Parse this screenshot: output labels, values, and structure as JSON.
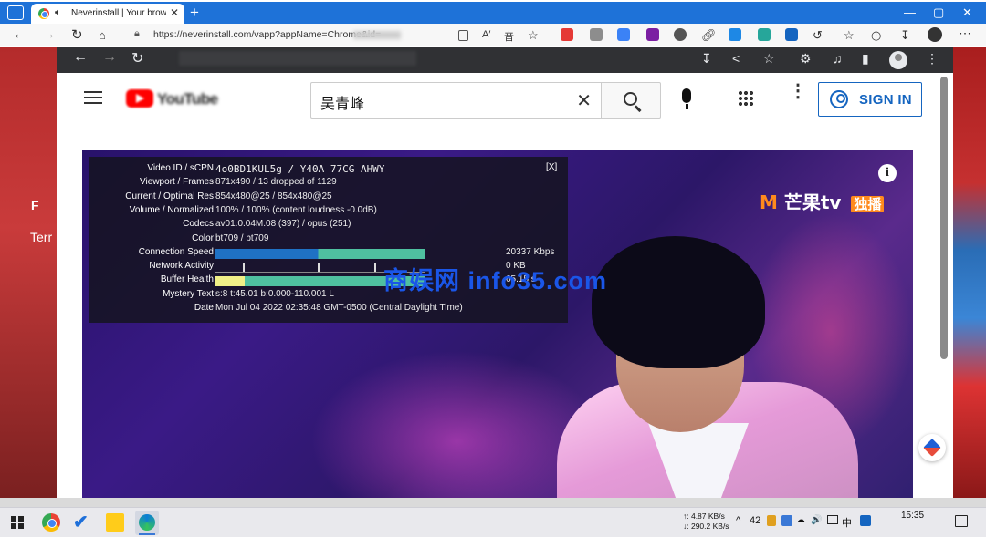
{
  "browser": {
    "tab_title": "Neverinstall | Your browser",
    "new_tab": "+",
    "tab_close": "✕",
    "url": "https://neverinstall.com/vapp?appName=Chrome&id=",
    "window_controls": {
      "minimize": "—",
      "maximize": "▢",
      "close": "✕"
    }
  },
  "desktop": {
    "left_label": "Terr",
    "left_letter": "F"
  },
  "youtube": {
    "logo_text": "YouTube",
    "search_value": "吴青峰",
    "clear_icon": "✕",
    "more_icon": "⋮",
    "sign_in": "SIGN IN"
  },
  "video": {
    "channel_logo_prefix": "M",
    "channel_logo": "芒果tv",
    "channel_badge": "独播",
    "info_icon": "i",
    "watermark": "商娱网 info35.com",
    "stats_close": "[X]",
    "stats": [
      {
        "key": "Video ID / sCPN",
        "value": "4o0BD1KUL5g / Y40A 77CG AHWY",
        "mono": true
      },
      {
        "key": "Viewport / Frames",
        "value": "871x490 / 13 dropped of 1129"
      },
      {
        "key": "Current / Optimal Res",
        "value": "854x480@25 / 854x480@25"
      },
      {
        "key": "Volume / Normalized",
        "value": "100% / 100% (content loudness -0.0dB)"
      },
      {
        "key": "Codecs",
        "value": "av01.0.04M.08 (397) / opus (251)"
      },
      {
        "key": "Color",
        "value": "bt709 / bt709"
      },
      {
        "key": "Connection Speed",
        "value": "20337 Kbps",
        "bar": "speed"
      },
      {
        "key": "Network Activity",
        "value": "0 KB",
        "bar": "net"
      },
      {
        "key": "Buffer Health",
        "value": "65.15 s",
        "bar": "buf"
      },
      {
        "key": "Mystery Text",
        "value": "s:8 t:45.01 b:0.000-110.001 L"
      },
      {
        "key": "Date",
        "value": "Mon Jul 04 2022 02:35:48 GMT-0500 (Central Daylight Time)"
      }
    ]
  },
  "taskbar": {
    "net_up": "↑: 4.87 KB/s",
    "net_down": "↓: 290.2 KB/s",
    "tray_caret": "^",
    "tray_count": "42",
    "tray_volume": "🔊",
    "tray_ime": "中",
    "clock": "15:35"
  }
}
